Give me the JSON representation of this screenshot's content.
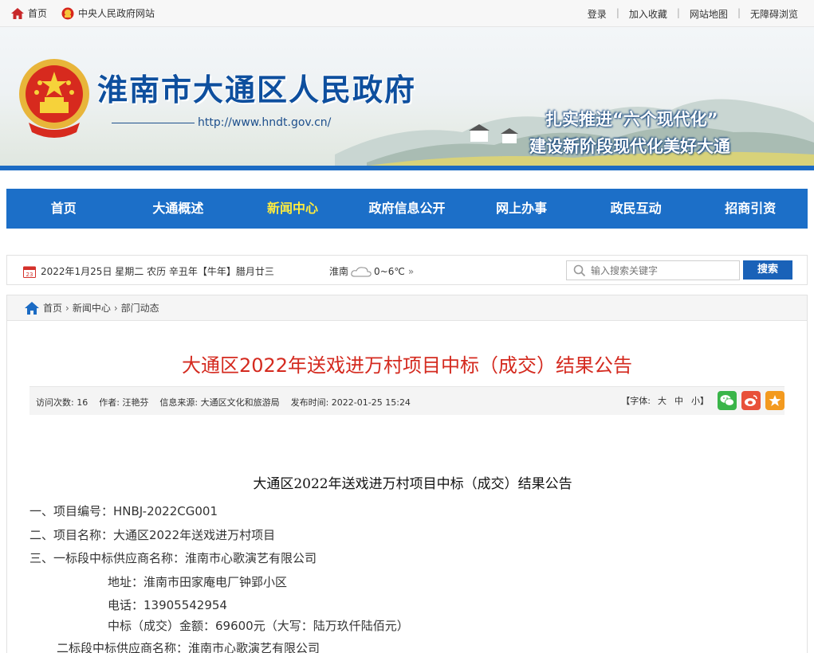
{
  "topbar": {
    "home": "首页",
    "gov_site": "中央人民政府网站",
    "login": "登录",
    "favorite": "加入收藏",
    "sitemap": "网站地图",
    "accessible": "无障碍浏览"
  },
  "banner": {
    "title": "淮南市大通区人民政府",
    "url": "http://www.hndt.gov.cn/",
    "slogan1": "扎实推进“六个现代化”",
    "slogan2": "建设新阶段现代化美好大通"
  },
  "nav": {
    "items": [
      "首页",
      "大通概述",
      "新闻中心",
      "政府信息公开",
      "网上办事",
      "政民互动",
      "招商引资"
    ],
    "active_index": 2
  },
  "infobar": {
    "date_icon_num": "23",
    "date_text": "2022年1月25日 星期二 农历 辛丑年【牛年】腊月廿三",
    "city": "淮南",
    "temp": "0~6℃",
    "search_placeholder": "输入搜索关键字",
    "search_button": "搜索"
  },
  "breadcrumb": {
    "items": [
      "首页",
      "新闻中心",
      "部门动态"
    ]
  },
  "article": {
    "title": "大通区2022年送戏进万村项目中标（成交）结果公告",
    "visits": "访问次数: 16",
    "author": "作者: 汪艳芬",
    "source": "信息来源: 大通区文化和旅游局",
    "publish": "发布时间: 2022-01-25 15:24",
    "font_label": "【字体:",
    "font_large": "大",
    "font_medium": "中",
    "font_small": "小】"
  },
  "content": {
    "doc_title": "大通区2022年送戏进万村项目中标（成交）结果公告",
    "l1": "一、项目编号：HNBJ-2022CG001",
    "l2": "二、项目名称：大通区2022年送戏进万村项目",
    "l3": "三、一标段中标供应商名称：淮南市心歌演艺有限公司",
    "l4": "地址：淮南市田家庵电厂钟郢小区",
    "l5": "电话：13905542954",
    "l6": "中标（成交）金额：69600元（大写：陆万玖仟陆佰元）",
    "l7": "二标段中标供应商名称：淮南市心歌演艺有限公司"
  },
  "colors": {
    "nav_bg": "#1c6fc8",
    "nav_active": "#ffec3d",
    "title_red": "#d42a1f",
    "banner_title": "#0e4f9e"
  }
}
